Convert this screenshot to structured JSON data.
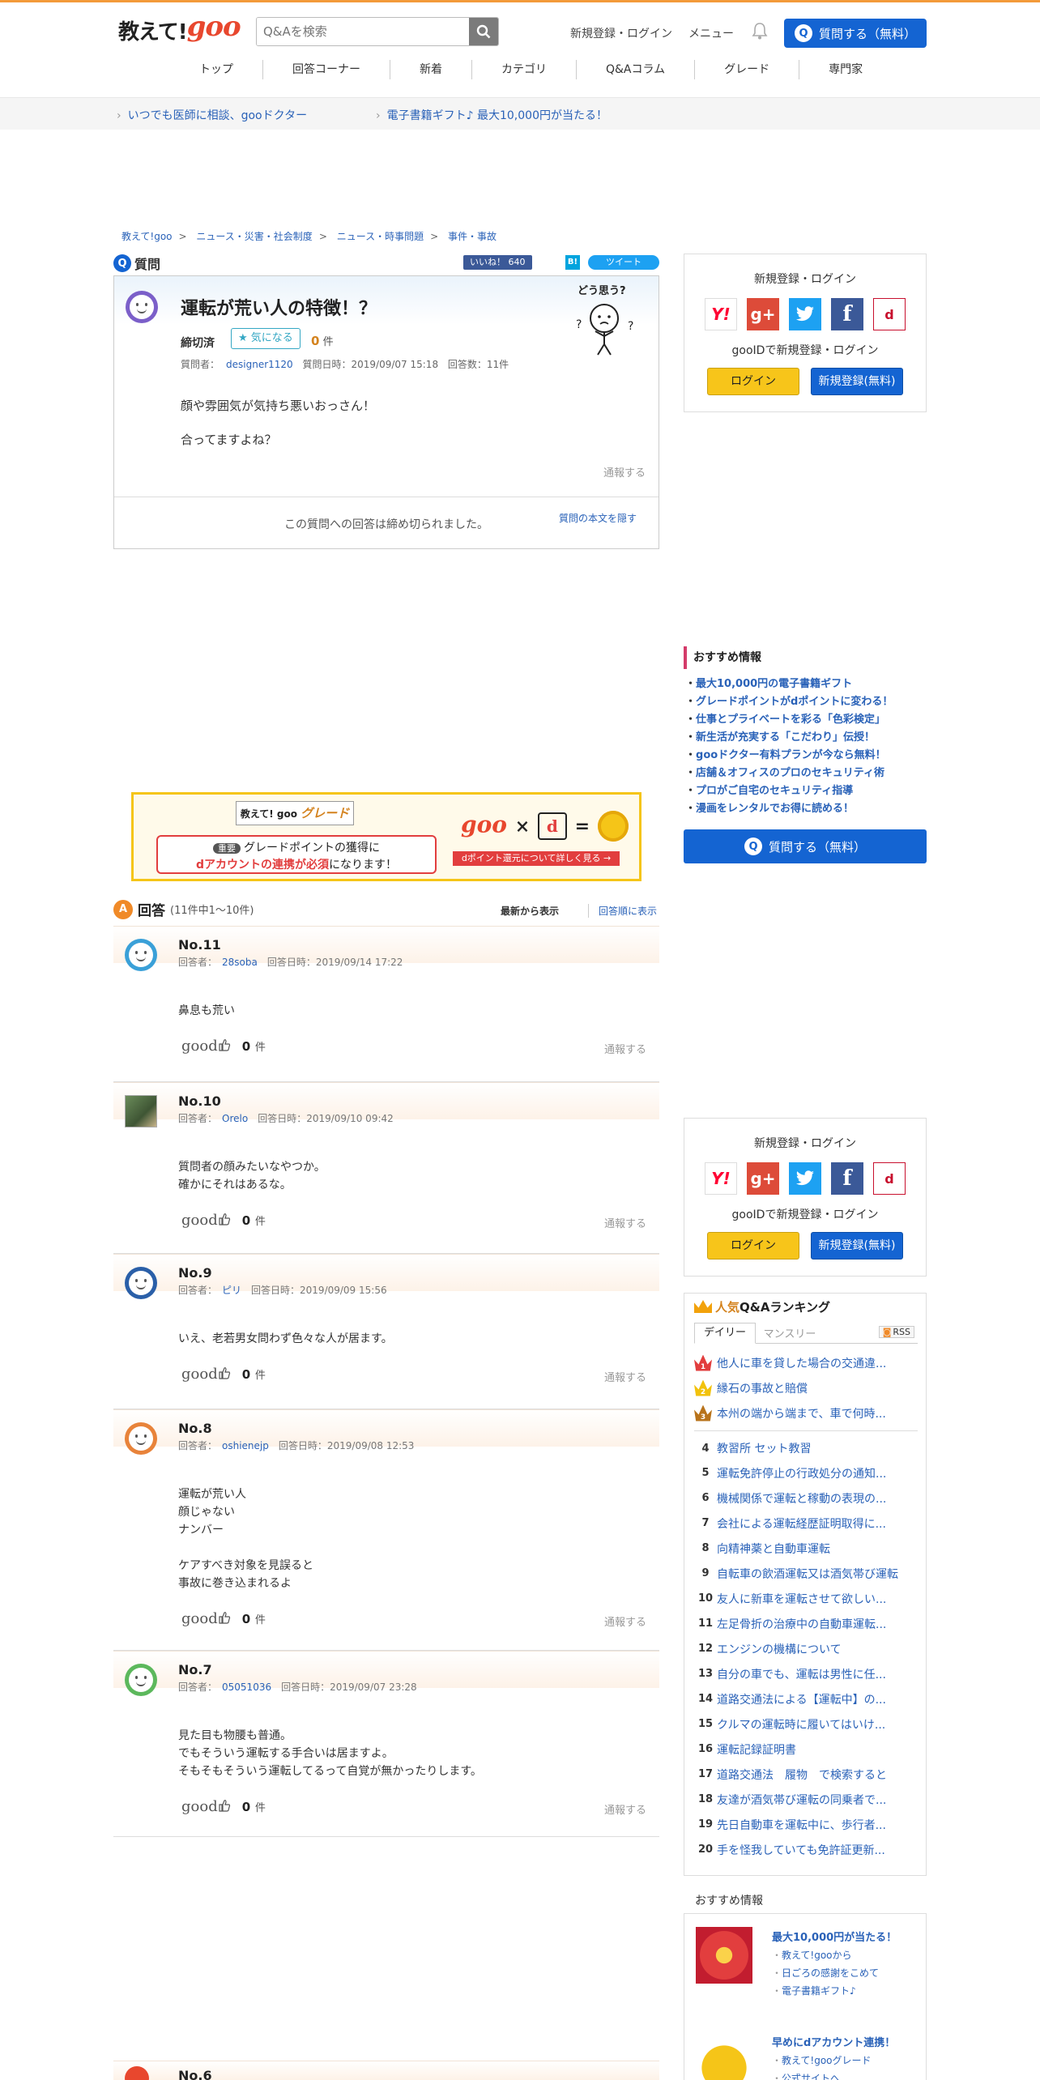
{
  "header": {
    "logo_text": "教えて!",
    "logo_goo": "goo",
    "search_placeholder": "Q&Aを検索",
    "login_link": "新規登録・ログイン",
    "menu_link": "メニュー",
    "ask_button": "質問する（無料）"
  },
  "nav": [
    "トップ",
    "回答コーナー",
    "新着",
    "カテゴリ",
    "Q&Aコラム",
    "グレード",
    "専門家"
  ],
  "promo": {
    "link1": "いつでも医師に相談、gooドクター",
    "link2": "電子書籍ギフト♪ 最大10,000円が当たる！"
  },
  "breadcrumb": [
    "教えて!goo",
    "ニュース・災害・社会制度",
    "ニュース・時事問題",
    "事件・事故"
  ],
  "question": {
    "section_label": "質問",
    "like_label": "いいね！ 640",
    "hatena_label": "B!",
    "tweet_label": "ツイート",
    "title": "運転が荒い人の特徴！？",
    "status": "締切済",
    "fav_label": "気になる",
    "fav_count": "0",
    "fav_unit": "件",
    "meta_questioner_label": "質問者：",
    "meta_questioner": "designer1120",
    "meta_date": "質問日時：2019/09/07 15:18",
    "meta_answers": "回答数：11件",
    "body_lines": [
      "顔や雰囲気が気持ち悪いおっさん！",
      "合ってますよね？"
    ],
    "report": "通報する",
    "closed_message": "この質問への回答は締め切られました。",
    "hide_body": "質問の本文を隠す",
    "mascot_text": "どう思う?"
  },
  "grade_banner": {
    "title_prefix": "教えて! goo",
    "title_word": "グレード",
    "tag": "重要",
    "line1": "グレードポイントの獲得に",
    "line2_red": "dアカウントの連携が必須",
    "line2_rest": "になります！",
    "goo": "goo",
    "times": "×",
    "d_mark": "d",
    "equals": "=",
    "link": "dポイント還元について詳しく見る →"
  },
  "answers_header": {
    "title": "回答",
    "range": "(11件中1～10件)",
    "sort_latest": "最新から表示",
    "sort_order": "回答順に表示"
  },
  "answers": [
    {
      "no": "No.11",
      "name_label": "回答者：",
      "name": "28soba",
      "date": "回答日時：2019/09/14 17:22",
      "body": "鼻息も荒い",
      "good": "good",
      "count": "0",
      "unit": "件",
      "report": "通報する",
      "avatar_color": "#3aa0d8"
    },
    {
      "no": "No.10",
      "name_label": "回答者：",
      "name": "Orelo",
      "date": "回答日時：2019/09/10 09:42",
      "body": "質問者の顔みたいなやつか。\n確かにそれはあるな。",
      "good": "good",
      "count": "0",
      "unit": "件",
      "report": "通報する",
      "avatar_color": "photo"
    },
    {
      "no": "No.9",
      "name_label": "回答者：",
      "name": "ピリ",
      "date": "回答日時：2019/09/09 15:56",
      "body": "いえ、老若男女問わず色々な人が居ます。",
      "good": "good",
      "count": "0",
      "unit": "件",
      "report": "通報する",
      "avatar_color": "#2a5fa8"
    },
    {
      "no": "No.8",
      "name_label": "回答者：",
      "name": "oshienejp",
      "date": "回答日時：2019/09/08 12:53",
      "body": "運転が荒い人\n顔じゃない\nナンバー\n\nケアすべき対象を見誤ると\n事故に巻き込まれるよ",
      "good": "good",
      "count": "0",
      "unit": "件",
      "report": "通報する",
      "avatar_color": "#e8833a"
    },
    {
      "no": "No.7",
      "name_label": "回答者：",
      "name": "05051036",
      "date": "回答日時：2019/09/07 23:28",
      "body": "見た目も物腰も普通。\nでもそういう運転する手合いは居ますよ。\nそもそもそういう運転してるって自覚が無かったりします。",
      "good": "good",
      "count": "0",
      "unit": "件",
      "report": "通報する",
      "avatar_color": "#5cb85c"
    },
    {
      "no": "No.6",
      "name_label": "",
      "name": "",
      "date": "",
      "body": "",
      "good": "",
      "count": "",
      "unit": "",
      "report": "",
      "avatar_color": "#e8472e"
    }
  ],
  "sidebar": {
    "login_title": "新規登録・ログイン",
    "sns": [
      "Y!",
      "g+",
      "t",
      "f",
      "d"
    ],
    "goo_register": "gooIDで新規登録・ログイン",
    "login_button": "ログイン",
    "register_button": "新規登録(無料)",
    "recommend_title": "おすすめ情報",
    "recommend": [
      "最大10,000円の電子書籍ギフト",
      "グレードポイントがdポイントに変わる！",
      "仕事とプライベートを彩る「色彩検定」",
      "新生活が充実する「こだわり」伝授！",
      "gooドクター有料プランが今なら無料！",
      "店舗＆オフィスのプロのセキュリティ術",
      "プロがご自宅のセキュリティ指導",
      "漫画をレンタルでお得に読める！"
    ],
    "ask_button": "質問する（無料）",
    "ranking_title_pop": "人気",
    "ranking_title_rest": "Q&Aランキング",
    "tab_daily": "デイリー",
    "tab_monthly": "マンスリー",
    "rss": "RSS",
    "ranking": [
      "他人に車を貸した場合の交通違...",
      "縁石の事故と賠償",
      "本州の端から端まで、車で何時...",
      "教習所 セット教習",
      "運転免許停止の行政処分の通知...",
      "機械関係で運転と稼動の表現の...",
      "会社による運転経歴証明取得に...",
      "向精神薬と自動車運転",
      "自転車の飲酒運転又は酒気帯び運転",
      "友人に新車を運転させて欲しい...",
      "左足骨折の治療中の自動車運転...",
      "エンジンの機構について",
      "自分の車でも、運転は男性に任...",
      "道路交通法による【運転中】の...",
      "クルマの運転時に履いてはいけ...",
      "運転記録証明書",
      "道路交通法　履物　で検索すると",
      "友達が酒気帯び運転の同乗者で...",
      "先日自動車を運転中に、歩行者...",
      "手を怪我していても免許証更新..."
    ],
    "rec2_title": "おすすめ情報",
    "rec2_block1_head": "最大10,000円が当たる！",
    "rec2_block1_items": [
      "教えて!gooから",
      "日ごろの感謝をこめて",
      "電子書籍ギフト♪"
    ],
    "rec2_block2_head": "早めにdアカウント連携！",
    "rec2_block2_items": [
      "教えて!gooグレード",
      "公式サイトへ"
    ]
  },
  "colors": {
    "accent_orange": "#f39a3a",
    "brand_blue": "#1464d2",
    "link_blue": "#2a62b8",
    "goo_red": "#e8472e"
  }
}
